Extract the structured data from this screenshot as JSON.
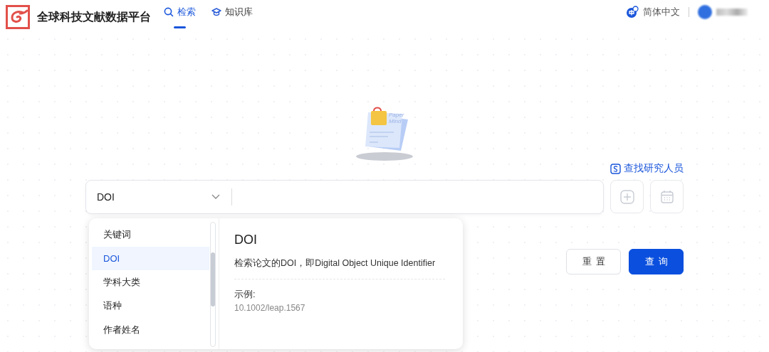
{
  "header": {
    "logo_text": "全球科技文献数据平台",
    "nav": [
      {
        "label": "检索",
        "selected": true
      },
      {
        "label": "知识库",
        "selected": false
      }
    ],
    "language": "简体中文"
  },
  "illustration": {
    "caption_line_1": "Paper",
    "caption_line_2": "Mind"
  },
  "find_researcher": "查找研究人员",
  "search": {
    "field_type": "DOI"
  },
  "dropdown": {
    "items": [
      {
        "label": "关键词",
        "selected": false
      },
      {
        "label": "DOI",
        "selected": true
      },
      {
        "label": "学科大类",
        "selected": false
      },
      {
        "label": "语种",
        "selected": false
      },
      {
        "label": "作者姓名",
        "selected": false
      }
    ],
    "detail": {
      "title": "DOI",
      "description": "检索论文的DOI，即Digital Object Unique Identifier",
      "example_label": "示例:",
      "example_value": "10.1002/leap.1567"
    }
  },
  "buttons": [
    {
      "label": "重置",
      "kind": "secondary"
    },
    {
      "label": "查询",
      "kind": "primary"
    }
  ]
}
